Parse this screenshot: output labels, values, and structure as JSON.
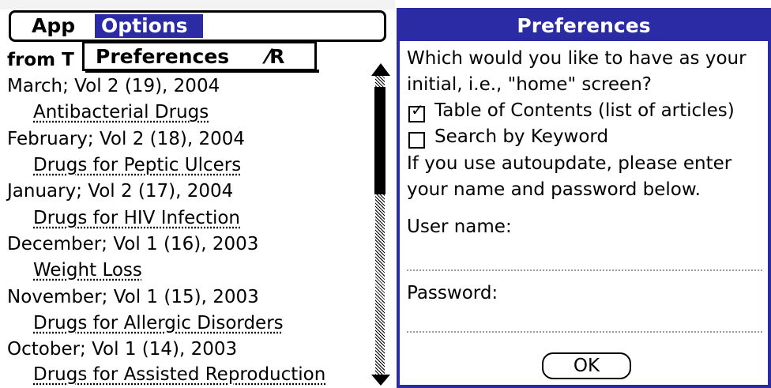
{
  "menu": {
    "app_label": "App",
    "options_label": "Options",
    "dropdown": {
      "item_label": "Preferences",
      "shortcut": "⁄R"
    }
  },
  "list": {
    "partial_header": "from T",
    "items": [
      {
        "date": "March; Vol 2 (19), 2004",
        "title": "Antibacterial Drugs"
      },
      {
        "date": "February; Vol 2 (18), 2004",
        "title": "Drugs for Peptic Ulcers"
      },
      {
        "date": "January; Vol 2 (17), 2004",
        "title": "Drugs for HIV Infection"
      },
      {
        "date": "December; Vol 1 (16), 2003",
        "title": "Weight Loss"
      },
      {
        "date": "November; Vol 1 (15), 2003",
        "title": "Drugs for Allergic Disorders"
      },
      {
        "date": "October; Vol 1 (14), 2003",
        "title": "Drugs for Assisted Reproduction"
      }
    ]
  },
  "dialog": {
    "title": "Preferences",
    "question_line1": "Which would you like to have as your",
    "question_line2": "initial, i.e., \"home\" screen?",
    "options": [
      {
        "label": "Table of Contents (list of articles)",
        "checked": true
      },
      {
        "label": "Search by Keyword",
        "checked": false
      }
    ],
    "autoupdate_line1": "If you use autoupdate, please enter",
    "autoupdate_line2": "your name and password below.",
    "username_label": "User name:",
    "username_value": "",
    "password_label": "Password:",
    "password_value": "",
    "ok_label": "OK"
  },
  "colors": {
    "accent": "#2b2ba6"
  }
}
